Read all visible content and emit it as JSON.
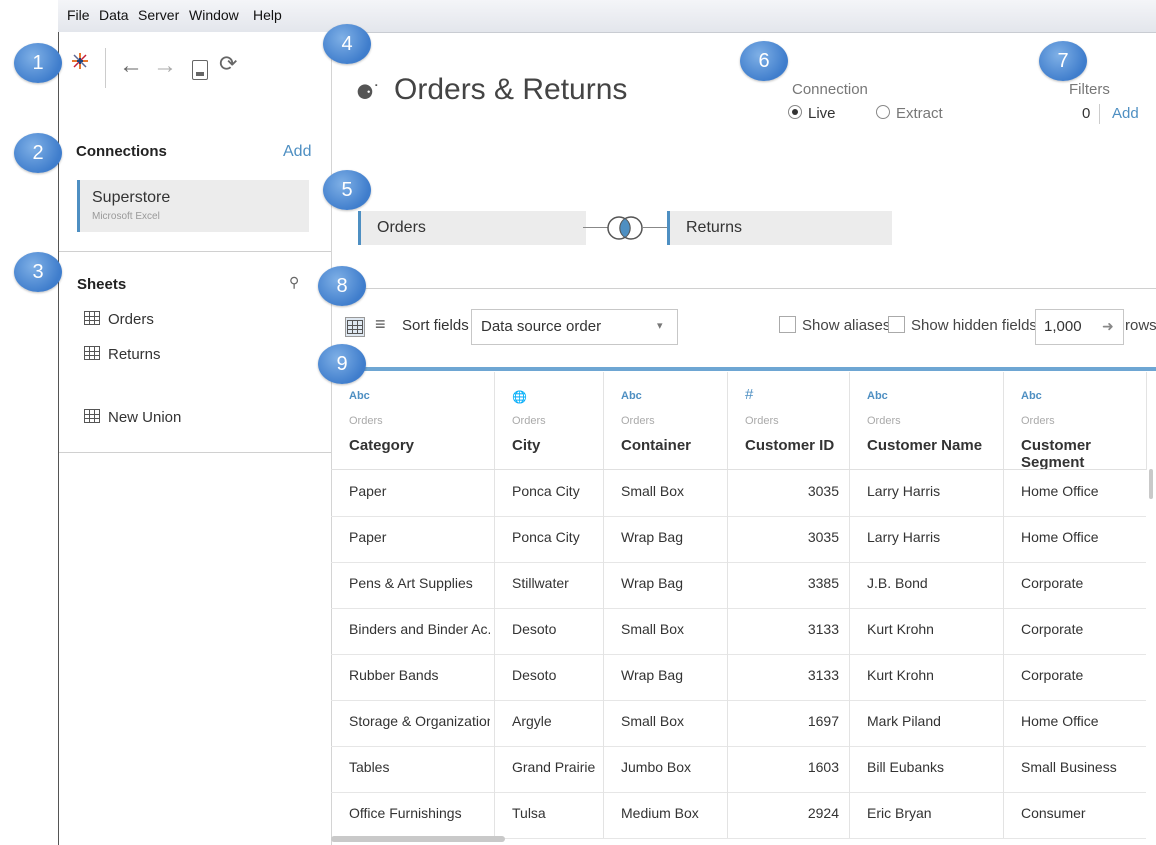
{
  "menu": [
    "File",
    "Data",
    "Server",
    "Window",
    "Help"
  ],
  "badges": [
    "1",
    "2",
    "3",
    "4",
    "5",
    "6",
    "7",
    "8",
    "9"
  ],
  "sidebar": {
    "connections_title": "Connections",
    "add_label": "Add",
    "connection": {
      "name": "Superstore",
      "type": "Microsoft Excel"
    },
    "sheets_title": "Sheets",
    "sheets": [
      "Orders",
      "Returns"
    ],
    "new_union": "New Union"
  },
  "main": {
    "title": "Orders & Returns",
    "connection_label": "Connection",
    "live_label": "Live",
    "extract_label": "Extract",
    "filters_label": "Filters",
    "filters_count": "0",
    "filters_add": "Add",
    "join_left": "Orders",
    "join_right": "Returns"
  },
  "grid_toolbar": {
    "sort_label": "Sort fields",
    "sort_value": "Data source order",
    "show_aliases": "Show aliases",
    "show_hidden": "Show hidden fields",
    "rows_value": "1,000",
    "rows_label": "rows"
  },
  "columns": [
    {
      "type": "Abc",
      "source": "Orders",
      "name": "Category"
    },
    {
      "type": "globe",
      "source": "Orders",
      "name": "City"
    },
    {
      "type": "Abc",
      "source": "Orders",
      "name": "Container"
    },
    {
      "type": "#",
      "source": "Orders",
      "name": "Customer ID"
    },
    {
      "type": "Abc",
      "source": "Orders",
      "name": "Customer Name"
    },
    {
      "type": "Abc",
      "source": "Orders",
      "name": "Customer Segment"
    }
  ],
  "rows": [
    [
      "Paper",
      "Ponca City",
      "Small Box",
      "3035",
      "Larry Harris",
      "Home Office"
    ],
    [
      "Paper",
      "Ponca City",
      "Wrap Bag",
      "3035",
      "Larry Harris",
      "Home Office"
    ],
    [
      "Pens & Art Supplies",
      "Stillwater",
      "Wrap Bag",
      "3385",
      "J.B. Bond",
      "Corporate"
    ],
    [
      "Binders and Binder Ac...",
      "Desoto",
      "Small Box",
      "3133",
      "Kurt Krohn",
      "Corporate"
    ],
    [
      "Rubber Bands",
      "Desoto",
      "Wrap Bag",
      "3133",
      "Kurt Krohn",
      "Corporate"
    ],
    [
      "Storage & Organization",
      "Argyle",
      "Small Box",
      "1697",
      "Mark Piland",
      "Home Office"
    ],
    [
      "Tables",
      "Grand Prairie",
      "Jumbo Box",
      "1603",
      "Bill Eubanks",
      "Small Business"
    ],
    [
      "Office Furnishings",
      "Tulsa",
      "Medium Box",
      "2924",
      "Eric Bryan",
      "Consumer"
    ]
  ],
  "colors": {
    "accent": "#4e8fc2",
    "badge": "#3f7dcc"
  }
}
